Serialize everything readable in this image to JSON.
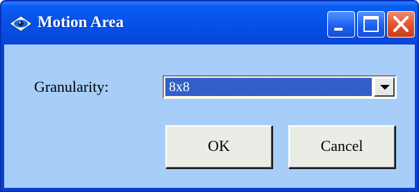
{
  "window": {
    "title": "Motion Area",
    "icon": "diamond-eye-icon",
    "controls": [
      "minimize-icon",
      "maximize-icon",
      "close-icon"
    ]
  },
  "form": {
    "granularity_label": "Granularity:",
    "granularity_selected": "8x8"
  },
  "buttons": {
    "ok_label": "OK",
    "cancel_label": "Cancel"
  },
  "colors": {
    "titlebar": "#0650e8",
    "client_background": "#a6cef8",
    "selection_highlight": "#3160c8",
    "close_button": "#e0532b"
  }
}
